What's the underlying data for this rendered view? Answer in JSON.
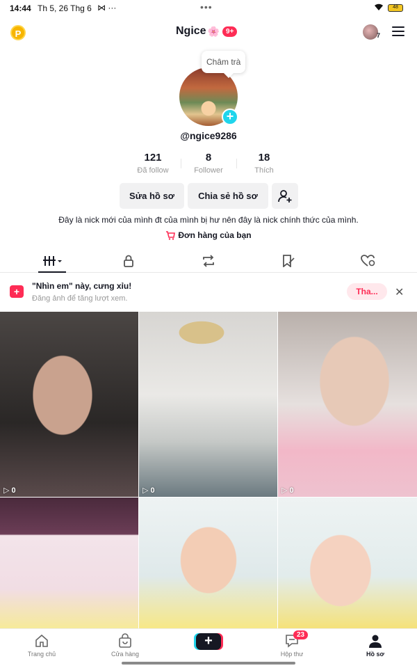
{
  "status": {
    "time": "14:44",
    "date": "Th 5, 26 Thg 6",
    "extra": "⋈ ···",
    "dots": "•••",
    "battery": "48"
  },
  "header": {
    "coin": "P",
    "username": "Ngice",
    "flower": "🌸",
    "notif_badge": "9+",
    "avatar_count": "7"
  },
  "profile": {
    "tooltip": "Châm trà",
    "handle": "@ngice9286",
    "stats": [
      {
        "num": "121",
        "label": "Đã follow"
      },
      {
        "num": "8",
        "label": "Follower"
      },
      {
        "num": "18",
        "label": "Thích"
      }
    ],
    "edit_label": "Sửa hồ sơ",
    "share_label": "Chia sẻ hồ sơ",
    "bio": "Đây là nick mới của mình đt của mình bị hư nên đây là nick chính thức của mình.",
    "orders": "Đơn hàng của bạn"
  },
  "tabs": [
    {
      "icon": "videos-grid-icon"
    },
    {
      "icon": "lock-icon"
    },
    {
      "icon": "repost-icon"
    },
    {
      "icon": "saved-icon"
    },
    {
      "icon": "liked-icon"
    }
  ],
  "promo": {
    "title": "\"Nhìn em\" này, cưng xỉu!",
    "subtitle": "Đăng ảnh để tăng lượt xem.",
    "button": "Tha...",
    "close": "✕"
  },
  "videos": [
    {
      "views": "0"
    },
    {
      "views": "0"
    },
    {
      "views": "0"
    },
    {
      "views": ""
    },
    {
      "views": ""
    },
    {
      "views": ""
    }
  ],
  "nav": {
    "home": "Trang chủ",
    "shop": "Cửa hàng",
    "inbox": "Hộp thư",
    "inbox_badge": "23",
    "profile": "Hồ sơ"
  },
  "colors": {
    "accent": "#fe2c55",
    "cyan": "#20d5ec",
    "text": "#161823"
  }
}
